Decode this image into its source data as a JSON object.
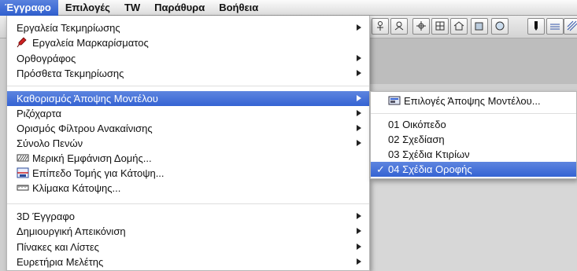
{
  "menubar": {
    "items": [
      "Έγγραφο",
      "Επιλογές",
      "TW",
      "Παράθυρα",
      "Βοήθεια"
    ],
    "active_index": 0
  },
  "menu": {
    "items": [
      {
        "label": "Εργαλεία Τεκμηρίωσης",
        "submenu": true
      },
      {
        "label": "Εργαλεία Μαρκαρίσματος",
        "icon": "marker-pen-icon"
      },
      {
        "label": "Ορθογράφος",
        "submenu": true
      },
      {
        "label": "Πρόσθετα Τεκμηρίωσης",
        "submenu": true
      },
      {
        "label": "Καθορισμός Άποψης Μοντέλου",
        "submenu": true,
        "selected": true
      },
      {
        "label": "Ριζόχαρτα",
        "submenu": true
      },
      {
        "label": "Ορισμός Φίλτρου Ανακαίνισης",
        "submenu": true
      },
      {
        "label": "Σύνολο Πενών",
        "submenu": true
      },
      {
        "label": "Μερική Εμφάνιση Δομής...",
        "icon": "hatch-structure-icon"
      },
      {
        "label": "Επίπεδο Τομής για Κάτοψη...",
        "icon": "section-plane-icon"
      },
      {
        "label": "Κλίμακα Κάτοψης...",
        "icon": "scale-icon"
      },
      {
        "label": "3D Έγγραφο",
        "submenu": true
      },
      {
        "label": "Δημιουργική Απεικόνιση",
        "submenu": true
      },
      {
        "label": "Πίνακες και Λίστες",
        "submenu": true
      },
      {
        "label": "Ευρετήρια Μελέτης",
        "submenu": true
      }
    ]
  },
  "submenu": {
    "items": [
      {
        "label": "Επιλογές Άποψης Μοντέλου...",
        "icon": "view-options-icon"
      },
      {
        "label": "01 Οικόπεδο"
      },
      {
        "label": "02 Σχεδίαση"
      },
      {
        "label": "03 Σχέδια Κτιρίων"
      },
      {
        "label": "04 Σχέδια Οροφής",
        "checked": true,
        "selected": true
      }
    ],
    "check_mark": "✓"
  },
  "colors": {
    "highlight": "#3563d3",
    "menu_bg": "#ffffff"
  }
}
